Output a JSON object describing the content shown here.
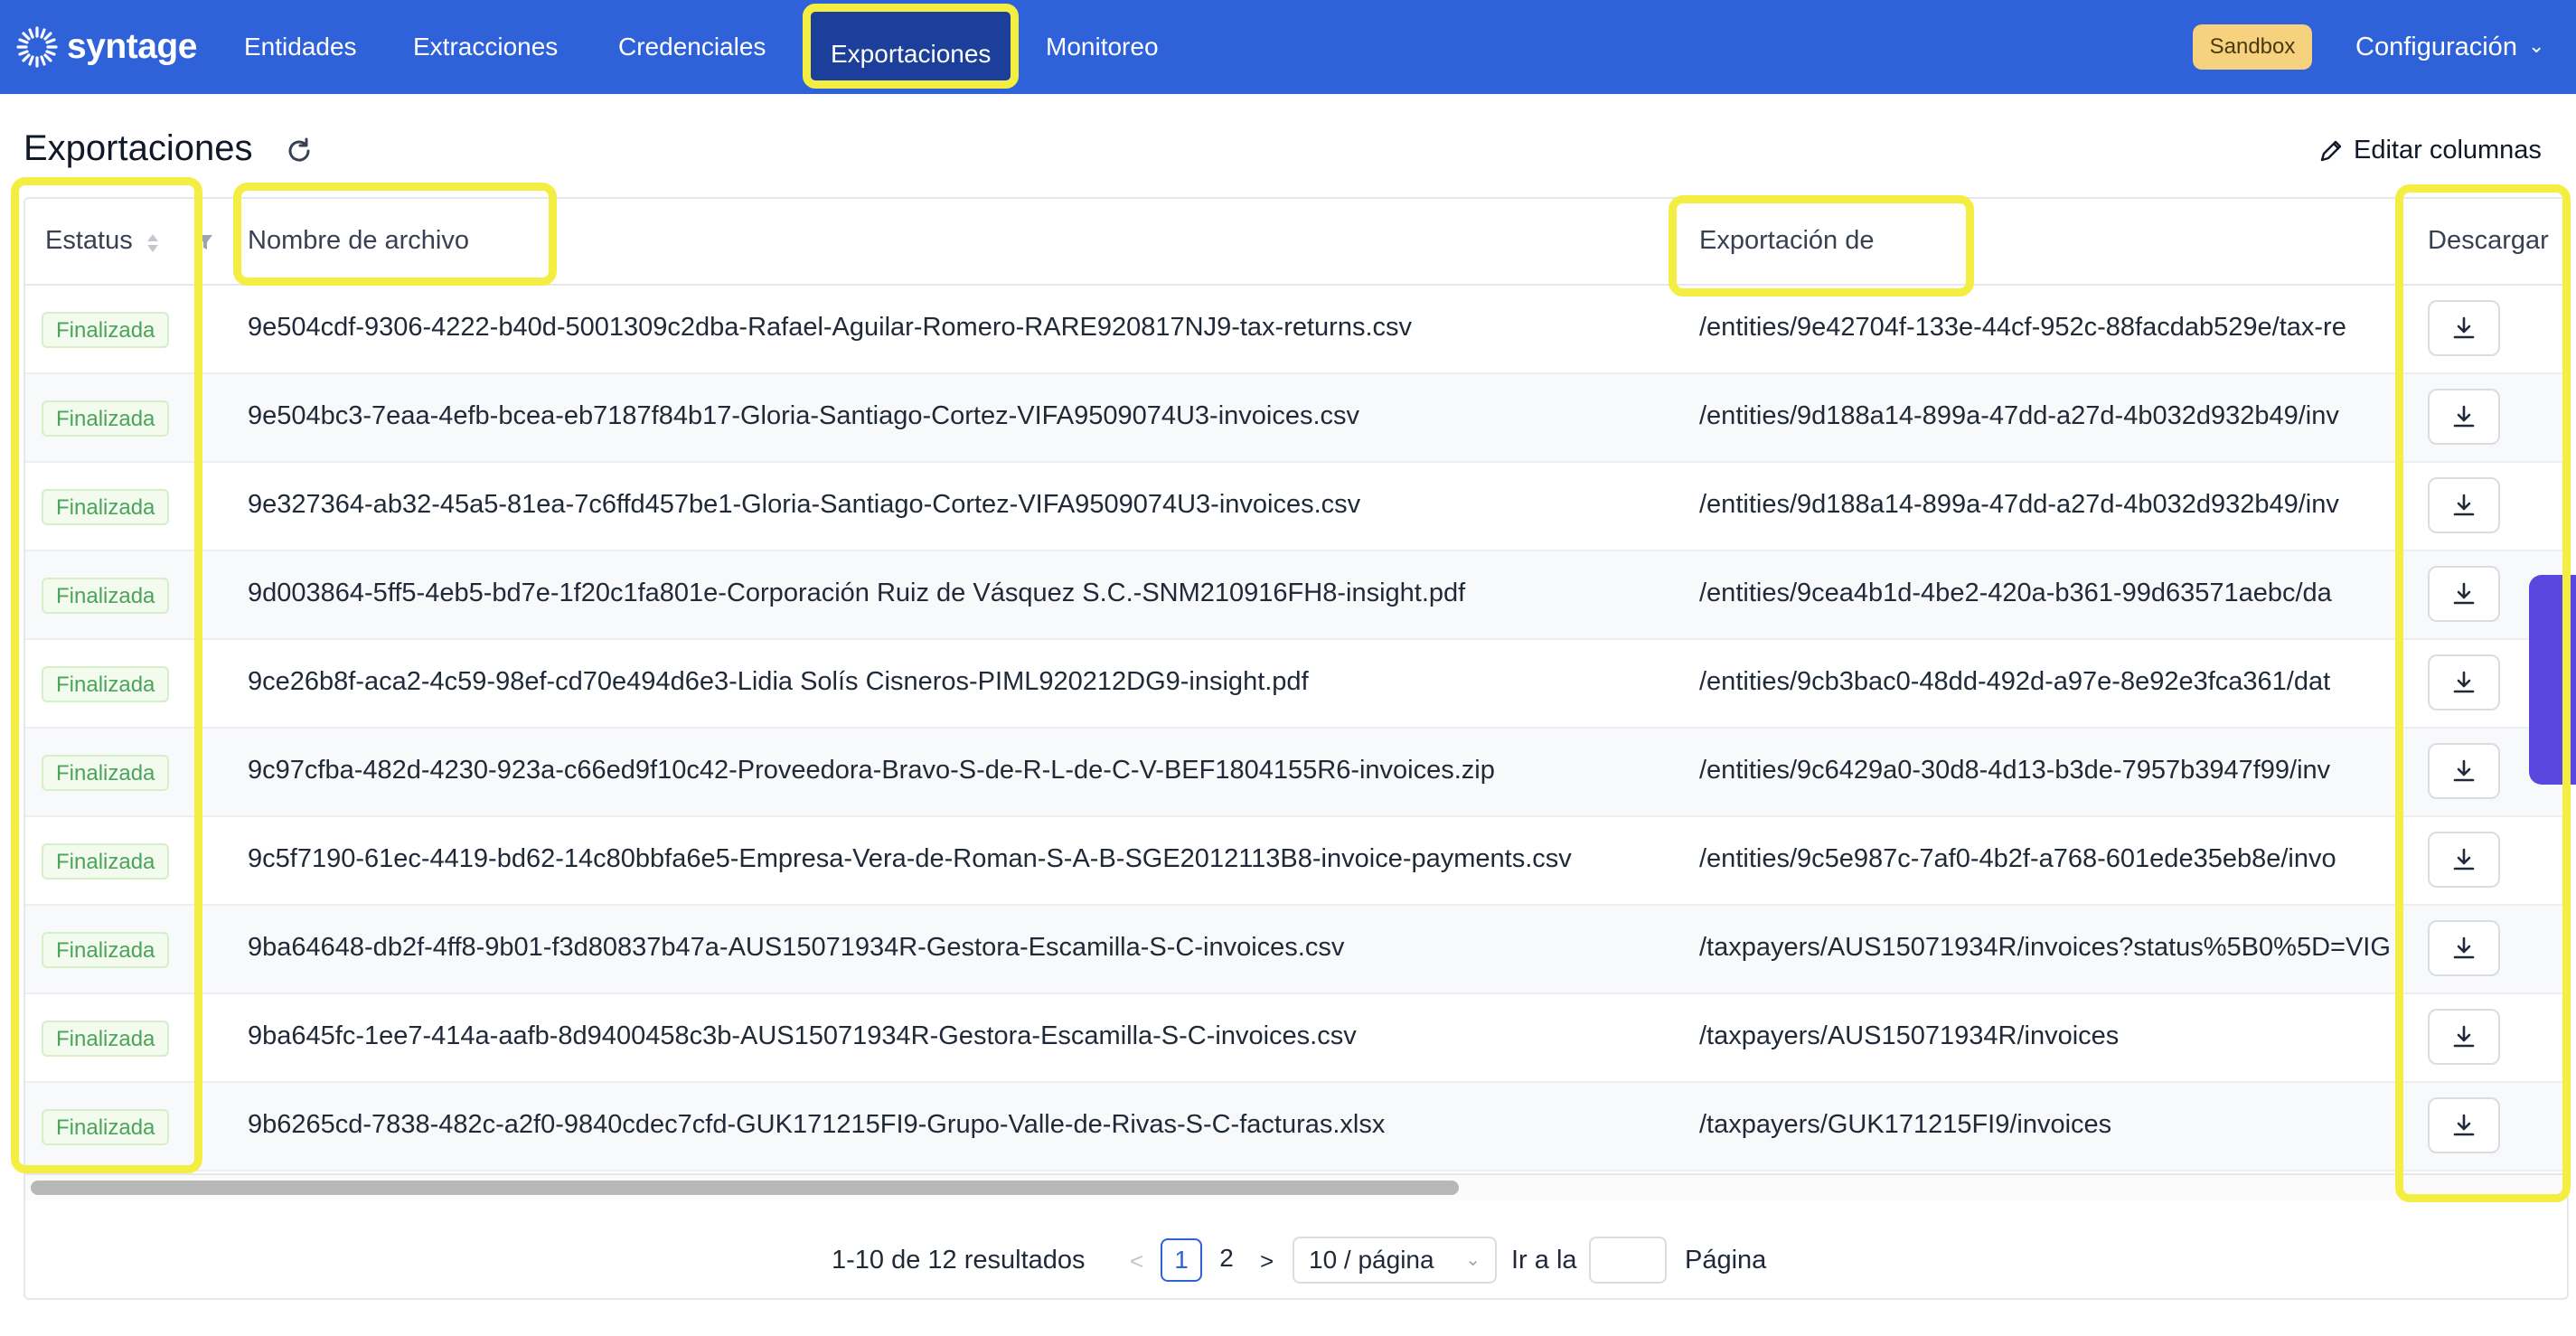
{
  "brand": {
    "name": "syntage"
  },
  "nav": {
    "items": [
      "Entidades",
      "Extracciones",
      "Credenciales",
      "Exportaciones",
      "Monitoreo"
    ],
    "active": "Exportaciones",
    "sandbox_label": "Sandbox",
    "config_label": "Configuración"
  },
  "page": {
    "title": "Exportaciones",
    "edit_columns_label": "Editar columnas"
  },
  "table": {
    "headers": {
      "status": "Estatus",
      "filename": "Nombre de archivo",
      "export_of": "Exportación de",
      "download": "Descargar"
    },
    "rows": [
      {
        "status": "Finalizada",
        "filename": "9e504cdf-9306-4222-b40d-5001309c2dba-Rafael-Aguilar-Romero-RARE920817NJ9-tax-returns.csv",
        "export_of": "/entities/9e42704f-133e-44cf-952c-88facdab529e/tax-re"
      },
      {
        "status": "Finalizada",
        "filename": "9e504bc3-7eaa-4efb-bcea-eb7187f84b17-Gloria-Santiago-Cortez-VIFA9509074U3-invoices.csv",
        "export_of": "/entities/9d188a14-899a-47dd-a27d-4b032d932b49/inv"
      },
      {
        "status": "Finalizada",
        "filename": "9e327364-ab32-45a5-81ea-7c6ffd457be1-Gloria-Santiago-Cortez-VIFA9509074U3-invoices.csv",
        "export_of": "/entities/9d188a14-899a-47dd-a27d-4b032d932b49/inv"
      },
      {
        "status": "Finalizada",
        "filename": "9d003864-5ff5-4eb5-bd7e-1f20c1fa801e-Corporación Ruiz de Vásquez S.C.-SNM210916FH8-insight.pdf",
        "export_of": "/entities/9cea4b1d-4be2-420a-b361-99d63571aebc/da"
      },
      {
        "status": "Finalizada",
        "filename": "9ce26b8f-aca2-4c59-98ef-cd70e494d6e3-Lidia Solís Cisneros-PIML920212DG9-insight.pdf",
        "export_of": "/entities/9cb3bac0-48dd-492d-a97e-8e92e3fca361/dat"
      },
      {
        "status": "Finalizada",
        "filename": "9c97cfba-482d-4230-923a-c66ed9f10c42-Proveedora-Bravo-S-de-R-L-de-C-V-BEF1804155R6-invoices.zip",
        "export_of": "/entities/9c6429a0-30d8-4d13-b3de-7957b3947f99/inv"
      },
      {
        "status": "Finalizada",
        "filename": "9c5f7190-61ec-4419-bd62-14c80bbfa6e5-Empresa-Vera-de-Roman-S-A-B-SGE2012113B8-invoice-payments.csv",
        "export_of": "/entities/9c5e987c-7af0-4b2f-a768-601ede35eb8e/invo"
      },
      {
        "status": "Finalizada",
        "filename": "9ba64648-db2f-4ff8-9b01-f3d80837b47a-AUS15071934R-Gestora-Escamilla-S-C-invoices.csv",
        "export_of": "/taxpayers/AUS15071934R/invoices?status%5B0%5D=VIG"
      },
      {
        "status": "Finalizada",
        "filename": "9ba645fc-1ee7-414a-aafb-8d9400458c3b-AUS15071934R-Gestora-Escamilla-S-C-invoices.csv",
        "export_of": "/taxpayers/AUS15071934R/invoices"
      },
      {
        "status": "Finalizada",
        "filename": "9b6265cd-7838-482c-a2f0-9840cdec7cfd-GUK171215FI9-Grupo-Valle-de-Rivas-S-C-facturas.xlsx",
        "export_of": "/taxpayers/GUK171215FI9/invoices"
      }
    ]
  },
  "pagination": {
    "summary": "1-10 de 12 resultados",
    "pages": [
      "1",
      "2"
    ],
    "current_page": "1",
    "page_size": "10 / página",
    "goto_label": "Ir a la",
    "page_label": "Página"
  },
  "icons": {
    "refresh": "refresh-icon",
    "edit": "pencil-icon",
    "download": "download-icon",
    "sort": "sort-icon",
    "filter": "filter-icon",
    "chevron": "chevron-down-icon"
  },
  "colors": {
    "nav_bg": "#2f62d8",
    "active_nav_bg": "#1c3f9b",
    "highlight": "#f4ee42",
    "sandbox_badge": "#f6d17e",
    "status_green": "#4ca35a",
    "side_tab": "#5848e0"
  }
}
